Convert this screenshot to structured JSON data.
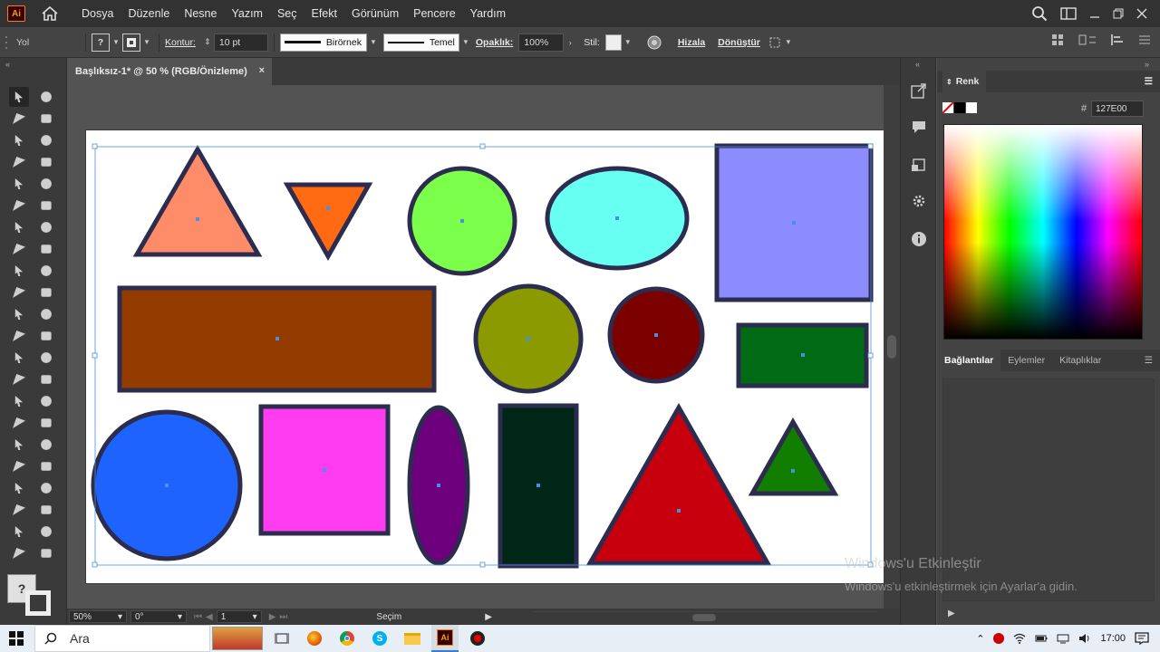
{
  "app": {
    "logo_text": "Ai",
    "menus": [
      "Dosya",
      "Düzenle",
      "Nesne",
      "Yazım",
      "Seç",
      "Efekt",
      "Görünüm",
      "Pencere",
      "Yardım"
    ]
  },
  "control_bar": {
    "selection_label": "Yol",
    "stroke_label": "Kontur:",
    "stroke_weight": "10 pt",
    "brush_profile": "Birörnek",
    "brush_style": "Temel",
    "opacity_label": "Opaklık:",
    "opacity_value": "100%",
    "style_label": "Stil:",
    "align_label": "Hizala",
    "transform_label": "Dönüştür"
  },
  "document": {
    "tab_title": "Başlıksız-1* @ 50 % (RGB/Önizleme)",
    "close_glyph": "×"
  },
  "status_bar": {
    "zoom": "50%",
    "rotation": "0°",
    "artboard_number": "1",
    "mode": "Seçim"
  },
  "color_panel": {
    "title": "Renk",
    "hex_label": "#",
    "hex_value": "127E00"
  },
  "links_panel": {
    "tabs": [
      "Bağlantılar",
      "Eylemler",
      "Kitaplıklar"
    ]
  },
  "watermark": {
    "line1": "Windows'u Etkinleştir",
    "line2": "Windows'u etkinleştirmek için Ayarlar'a gidin."
  },
  "taskbar": {
    "search_placeholder": "Ara",
    "clock": "17:00"
  },
  "shapes": [
    {
      "name": "triangle-salmon",
      "kind": "triangle-up",
      "fill": "#ff8c69"
    },
    {
      "name": "triangle-orange",
      "kind": "triangle-down",
      "fill": "#ff6a13"
    },
    {
      "name": "circle-green",
      "kind": "circle",
      "fill": "#7bff4a"
    },
    {
      "name": "ellipse-cyan",
      "kind": "ellipse",
      "fill": "#66fff2"
    },
    {
      "name": "square-lavender",
      "kind": "rect",
      "fill": "#8c8cff"
    },
    {
      "name": "rect-brown",
      "kind": "rect",
      "fill": "#943b00"
    },
    {
      "name": "circle-olive",
      "kind": "circle",
      "fill": "#8a9a00"
    },
    {
      "name": "circle-maroon",
      "kind": "circle",
      "fill": "#7d0000"
    },
    {
      "name": "rect-darkgreen",
      "kind": "rect",
      "fill": "#006a14"
    },
    {
      "name": "circle-blue",
      "kind": "circle",
      "fill": "#1f63ff"
    },
    {
      "name": "square-magenta",
      "kind": "rect",
      "fill": "#ff3df0"
    },
    {
      "name": "ellipse-purple",
      "kind": "ellipse",
      "fill": "#6f007d"
    },
    {
      "name": "rect-darkteal",
      "kind": "rect",
      "fill": "#002618"
    },
    {
      "name": "triangle-red",
      "kind": "triangle-up",
      "fill": "#c8000e"
    },
    {
      "name": "triangle-green",
      "kind": "triangle-up",
      "fill": "#127e00"
    }
  ],
  "colors": {
    "stroke": "#2c2c4e",
    "selection": "#4a90e2",
    "ui_dark": "#323232"
  }
}
